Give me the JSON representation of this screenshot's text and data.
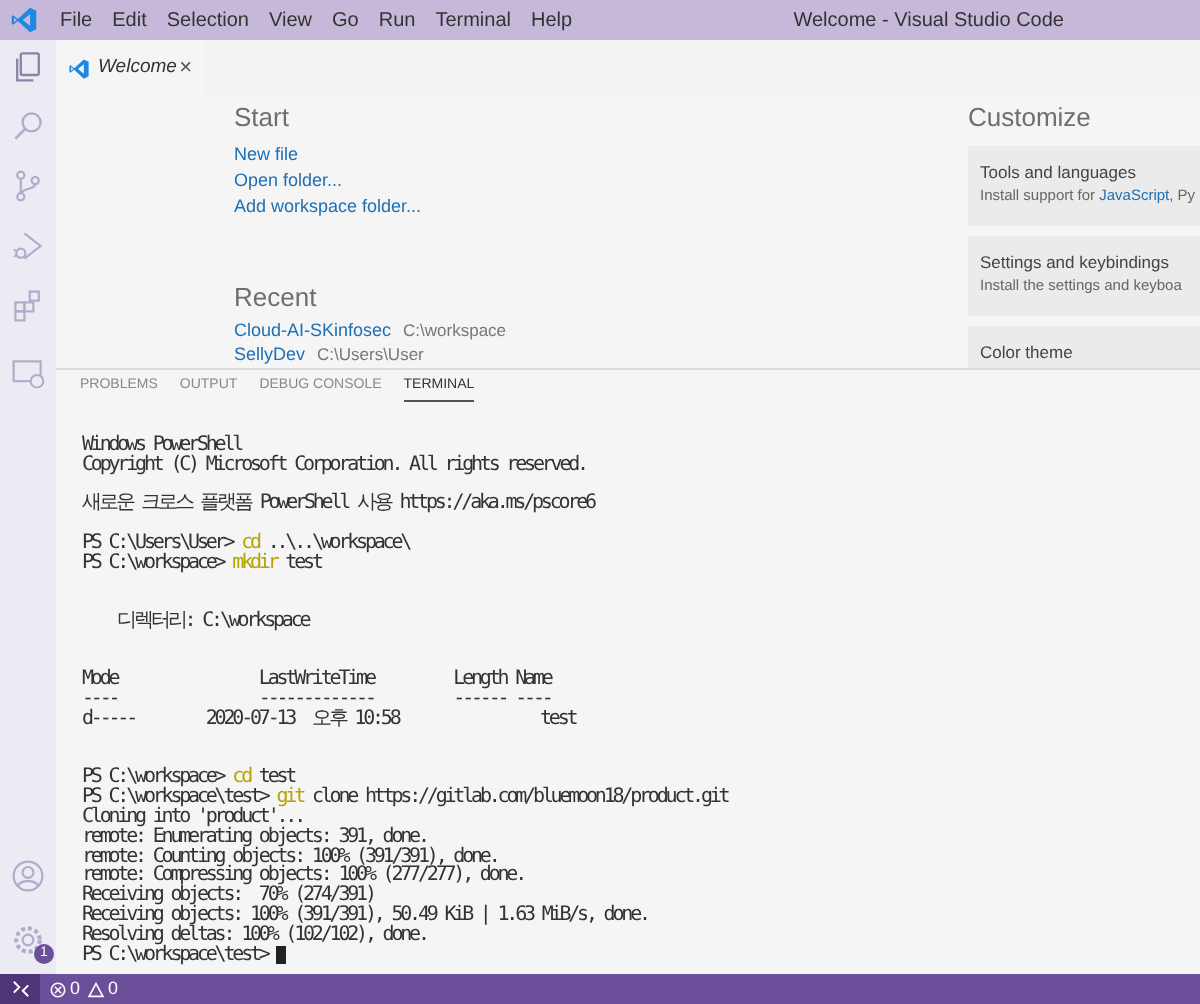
{
  "menu_bar": {
    "items": [
      "File",
      "Edit",
      "Selection",
      "View",
      "Go",
      "Run",
      "Terminal",
      "Help"
    ]
  },
  "window": {
    "title": "Welcome - Visual Studio Code"
  },
  "activity_bar": [
    {
      "kind": "explorer",
      "selected": true
    },
    {
      "kind": "search",
      "selected": false
    },
    {
      "kind": "source-control",
      "selected": false
    },
    {
      "kind": "run",
      "selected": false
    },
    {
      "kind": "extensions",
      "selected": false
    },
    {
      "kind": "remote",
      "selected": false
    }
  ],
  "activity_bar_bottom": [
    {
      "kind": "account"
    },
    {
      "kind": "settings",
      "badge": "1"
    }
  ],
  "editor_tabs": [
    {
      "label": "Welcome",
      "close": "×"
    }
  ],
  "welcome": {
    "start": {
      "heading": "Start",
      "links": [
        "New file",
        "Open folder...",
        "Add workspace folder..."
      ]
    },
    "recent": {
      "heading": "Recent",
      "items": [
        {
          "name": "Cloud-AI-SKinfosec",
          "path": "C:\\workspace"
        },
        {
          "name": "SellyDev",
          "path": "C:\\Users\\User"
        }
      ]
    },
    "customize": {
      "heading": "Customize",
      "cards": [
        {
          "title": "Tools and languages",
          "description": [
            {
              "text": "Install support for ",
              "link": false
            },
            {
              "text": "JavaScript",
              "link": true
            },
            {
              "text": ", Py",
              "link": false
            }
          ]
        },
        {
          "title": "Settings and keybindings",
          "description": [
            {
              "text": "Install the settings and keyboa",
              "link": false
            }
          ]
        },
        {
          "title": "Color theme"
        }
      ]
    }
  },
  "panel": {
    "tabs": [
      {
        "label": "PROBLEMS",
        "selected": false
      },
      {
        "label": "OUTPUT",
        "selected": false
      },
      {
        "label": "DEBUG CONSOLE",
        "selected": false
      },
      {
        "label": "TERMINAL",
        "selected": true
      }
    ],
    "terminal_blocks": [
      [
        [
          {
            "text": "Windows PowerShell",
            "kind": "plain"
          }
        ],
        [
          {
            "text": "Copyright (C) Microsoft Corporation. All rights reserved.",
            "kind": "plain"
          }
        ]
      ],
      [
        [
          {
            "text": "새로운 크로스 플랫폼 PowerShell 사용 https://aka.ms/pscore6",
            "kind": "plain"
          }
        ]
      ],
      [
        [
          {
            "text": "PS C:\\Users\\User> ",
            "kind": "plain"
          },
          {
            "text": "cd",
            "kind": "command"
          },
          {
            "text": " ..\\..\\workspace\\",
            "kind": "plain"
          }
        ],
        [
          {
            "text": "PS C:\\workspace> ",
            "kind": "plain"
          },
          {
            "text": "mkdir",
            "kind": "command"
          },
          {
            "text": " test",
            "kind": "plain"
          }
        ]
      ],
      [
        [
          {
            "text": "    디렉터리: C:\\workspace",
            "kind": "plain"
          }
        ]
      ],
      [
        [
          {
            "text": "Mode                LastWriteTime         Length Name",
            "kind": "plain"
          }
        ],
        [
          {
            "text": "----                -------------         ------ ----",
            "kind": "plain"
          }
        ],
        [
          {
            "text": "d-----        2020-07-13  오후 10:58                test",
            "kind": "plain"
          }
        ]
      ],
      [
        [
          {
            "text": "PS C:\\workspace> ",
            "kind": "plain"
          },
          {
            "text": "cd",
            "kind": "command"
          },
          {
            "text": " test",
            "kind": "plain"
          }
        ],
        [
          {
            "text": "PS C:\\workspace\\test> ",
            "kind": "plain"
          },
          {
            "text": "git",
            "kind": "command"
          },
          {
            "text": " clone https://gitlab.com/bluemoon18/product.git",
            "kind": "plain"
          }
        ],
        [
          {
            "text": "Cloning into 'product'...",
            "kind": "plain"
          }
        ],
        [
          {
            "text": "remote: Enumerating objects: 391, done.",
            "kind": "plain"
          }
        ],
        [
          {
            "text": "remote: Counting objects: 100% (391/391), done.",
            "kind": "plain"
          }
        ],
        [
          {
            "text": "remote: Compressing objects: 100% (277/277), done.",
            "kind": "plain"
          }
        ],
        [
          {
            "text": "Receiving objects:  70% (274/391)",
            "kind": "plain"
          }
        ],
        [
          {
            "text": "Receiving objects: 100% (391/391), 50.49 KiB | 1.63 MiB/s, done.",
            "kind": "plain"
          }
        ],
        [
          {
            "text": "Resolving deltas: 100% (102/102), done.",
            "kind": "plain"
          }
        ],
        [
          {
            "text": "PS C:\\workspace\\test> ",
            "kind": "plain"
          },
          {
            "kind": "cursor"
          }
        ]
      ]
    ]
  },
  "status_bar": {
    "remote": {
      "kind": "remote"
    },
    "errors": "0",
    "warnings": "0"
  }
}
